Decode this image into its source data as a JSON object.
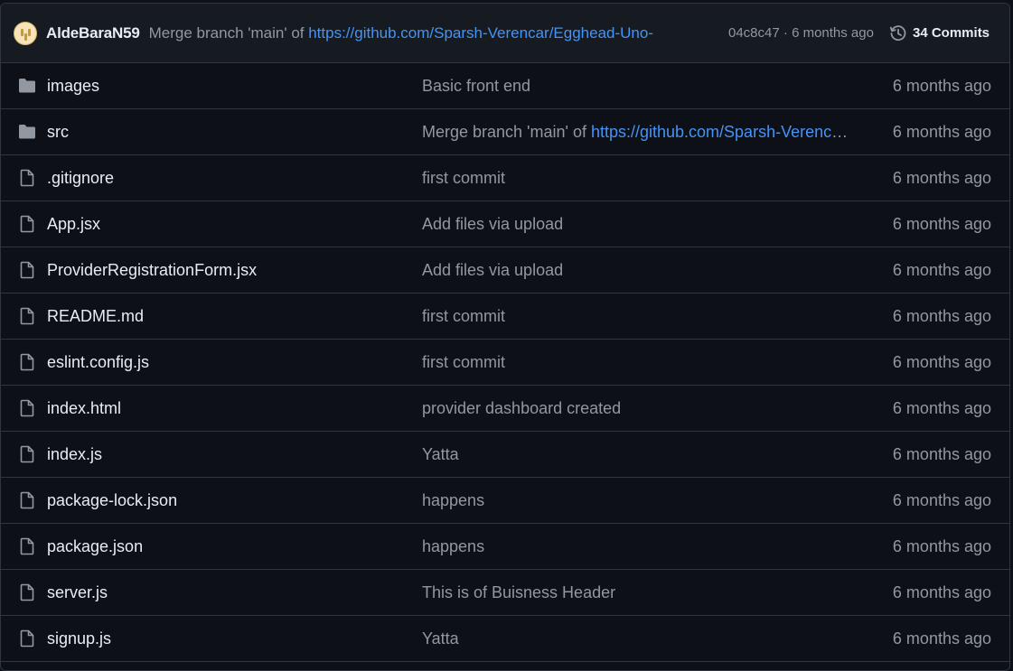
{
  "latest_commit": {
    "author": "AldeBaraN59",
    "message_prefix": "Merge branch 'main' of ",
    "message_link": "https://github.com/Sparsh-Verencar/Egghead-Uno-",
    "hash": "04c8c47",
    "separator": " · ",
    "age": "6 months ago",
    "commits_label": "34 Commits"
  },
  "colors": {
    "background": "#0d1117",
    "header_bg": "#161b22",
    "border": "#30363d",
    "link": "#4493f8",
    "muted": "#9198a1"
  },
  "files": [
    {
      "type": "folder",
      "name": "images",
      "msg": "Basic front end",
      "age": "6 months ago"
    },
    {
      "type": "folder",
      "name": "src",
      "msg_prefix": "Merge branch 'main' of ",
      "msg_link": "https://github.com/Sparsh-Verencar/Egghead-Uno",
      "age": "6 months ago"
    },
    {
      "type": "file",
      "name": ".gitignore",
      "msg": "first commit",
      "age": "6 months ago"
    },
    {
      "type": "file",
      "name": "App.jsx",
      "msg": "Add files via upload",
      "age": "6 months ago"
    },
    {
      "type": "file",
      "name": "ProviderRegistrationForm.jsx",
      "msg": "Add files via upload",
      "age": "6 months ago"
    },
    {
      "type": "file",
      "name": "README.md",
      "msg": "first commit",
      "age": "6 months ago"
    },
    {
      "type": "file",
      "name": "eslint.config.js",
      "msg": "first commit",
      "age": "6 months ago"
    },
    {
      "type": "file",
      "name": "index.html",
      "msg": "provider dashboard created",
      "age": "6 months ago"
    },
    {
      "type": "file",
      "name": "index.js",
      "msg": "Yatta",
      "age": "6 months ago"
    },
    {
      "type": "file",
      "name": "package-lock.json",
      "msg": "happens",
      "age": "6 months ago"
    },
    {
      "type": "file",
      "name": "package.json",
      "msg": "happens",
      "age": "6 months ago"
    },
    {
      "type": "file",
      "name": "server.js",
      "msg": "This is of Buisness Header",
      "age": "6 months ago"
    },
    {
      "type": "file",
      "name": "signup.js",
      "msg": "Yatta",
      "age": "6 months ago"
    }
  ]
}
